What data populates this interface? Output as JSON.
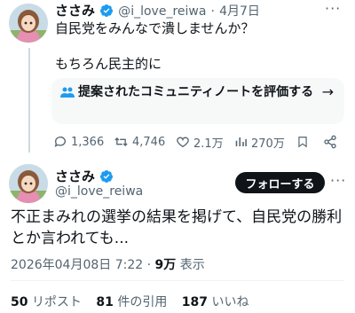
{
  "first_tweet": {
    "display_name": "ささみ",
    "handle": "@i_love_reiwa",
    "separator": "·",
    "date": "4月7日",
    "text_line1": "自民党をみんなで潰しませんか？",
    "text_line2": "もちろん民主的に",
    "community_note_prompt": "提案されたコミュニティノートを評価する",
    "community_note_arrow": "→",
    "actions": {
      "replies": "1,366",
      "retweets": "4,746",
      "likes": "2.1万",
      "views": "270万"
    },
    "more": "···"
  },
  "main_tweet": {
    "display_name": "ささみ",
    "handle": "@i_love_reiwa",
    "follow_label": "フォローする",
    "more": "···",
    "text": "不正まみれの選挙の結果を掲げて、自民党の勝利とか言われても...",
    "timestamp": "2026年04月08日 7:22",
    "dot": "·",
    "views_count": "9万",
    "views_label": "表示",
    "stats": {
      "reposts_count": "50",
      "reposts_label": "リポスト",
      "quotes_count": "81",
      "quotes_label": "件の引用",
      "likes_count": "187",
      "likes_label": "いいね"
    }
  },
  "colors": {
    "text": "#0f1419",
    "secondary": "#536471",
    "verified": "#1d9bf0",
    "follow_bg": "#0f1419",
    "card_bg": "#f7f9f9"
  }
}
